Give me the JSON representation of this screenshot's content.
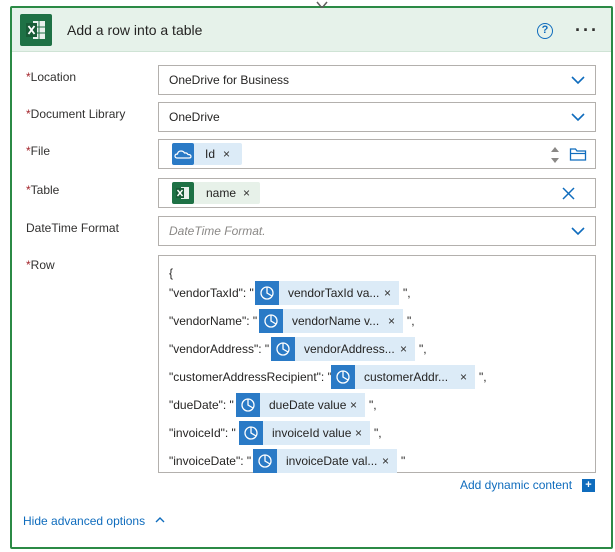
{
  "header": {
    "title": "Add a row into a table",
    "help_glyph": "?",
    "more_glyph": "···"
  },
  "fields": {
    "location": {
      "label": "Location",
      "required_mark": "*",
      "value": "OneDrive for Business"
    },
    "document_library": {
      "label": "Document Library",
      "required_mark": "*",
      "value": "OneDrive"
    },
    "file": {
      "label": "File",
      "required_mark": "*",
      "token": "Id"
    },
    "table": {
      "label": "Table",
      "required_mark": "*",
      "token": "name"
    },
    "datetime_format": {
      "label": "DateTime Format",
      "placeholder": "DateTime Format."
    },
    "row": {
      "label": "Row",
      "required_mark": "*",
      "open_brace": "{"
    }
  },
  "row_lines": [
    {
      "key": "\"vendorTaxId\": \"",
      "token": "vendorTaxId va...",
      "trail": "\","
    },
    {
      "key": "\"vendorName\": \"",
      "token": "vendorName v...",
      "trail": "\","
    },
    {
      "key": "\"vendorAddress\": \"",
      "token": "vendorAddress...",
      "trail": "\","
    },
    {
      "key": "\"customerAddressRecipient\": \"",
      "token": "customerAddr...",
      "trail": "\","
    },
    {
      "key": "\"dueDate\": \"",
      "token": "dueDate value",
      "trail": "\","
    },
    {
      "key": "\"invoiceId\": \"",
      "token": "invoiceId value",
      "trail": "\","
    },
    {
      "key": "\"invoiceDate\": \"",
      "token": "invoiceDate val...",
      "trail": "\""
    }
  ],
  "chip_close": "×",
  "add_dynamic_content": "Add dynamic content",
  "add_dynamic_glyph": "+",
  "hide_advanced": "Hide advanced options",
  "colors": {
    "brand_green": "#1e7145",
    "border_green": "#2b8a45",
    "header_bg": "#e6f2ea",
    "link_blue": "#0f6cbd",
    "token_blue": "#2a7ac6",
    "required_red": "#a4262c"
  }
}
